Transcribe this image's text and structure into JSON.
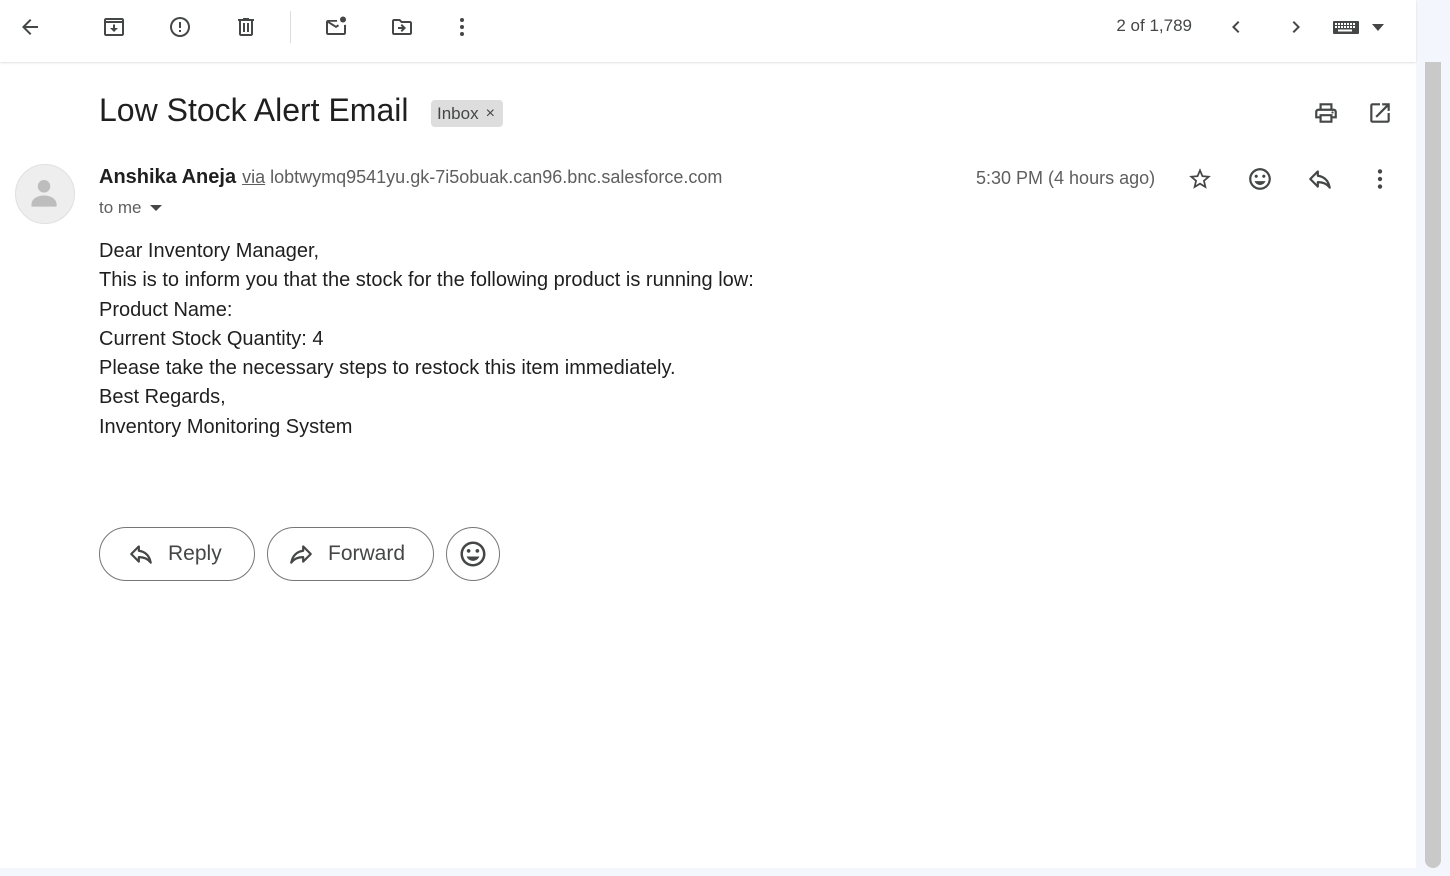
{
  "toolbar": {
    "counter": "2 of 1,789",
    "buttons": [
      "back",
      "archive",
      "report-spam",
      "delete",
      "mark-unread",
      "move-to",
      "more",
      "newer",
      "older",
      "input-tools"
    ]
  },
  "message": {
    "subject": "Low Stock Alert Email",
    "label": "Inbox",
    "label_remove": "×",
    "sender_name": "Anshika Aneja",
    "via": "via",
    "sender_address": "lobtwymq9541yu.gk-7i5obuak.can96.bnc.salesforce.com",
    "recipient": "to me",
    "time": "5:30 PM (4 hours ago)",
    "body": [
      "Dear Inventory Manager,",
      "This is to inform you that the stock for the following product is running low:",
      "Product Name:",
      "Current Stock Quantity: 4",
      "Please take the necessary steps to restock this item immediately.",
      "Best Regards,",
      "Inventory Monitoring System"
    ]
  },
  "actions": {
    "reply": "Reply",
    "forward": "Forward"
  },
  "colors": {
    "chip": "#dddddd",
    "icon": "#444746",
    "text": "#1f1f1f",
    "muted": "#5e5e5e",
    "rail": "#f3f6fc"
  }
}
